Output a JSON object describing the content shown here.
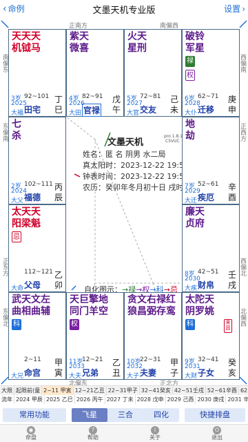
{
  "header": {
    "back_label": "命例",
    "title": "文墨天机专业版",
    "settings_label": "设置"
  },
  "directions": {
    "top_left": "正南方",
    "top_right": "南偏西",
    "left_upper": "南偏东",
    "right_upper": "西偏南",
    "left_mid": "东偏南",
    "right_mid": "正西方",
    "left_lower": "正东方",
    "right_lower": "西偏北",
    "left_bottom": "东偏北",
    "right_bottom": "北偏西",
    "bottom_left": "北偏东",
    "bottom_right": "正北方"
  },
  "palaces": [
    {
      "id": "si",
      "stars": "天天天\n机钺马",
      "color": "red",
      "age": "3岁",
      "range": "92~101",
      "year": "2025",
      "tag": "大福",
      "name": "田宅",
      "stem": "丁",
      "branch": "巳",
      "badges": []
    },
    {
      "id": "wu",
      "stars": "紫天\n微喜",
      "color": "purple",
      "age": "4岁",
      "range": "82~91",
      "year": "2026",
      "tag": "大田",
      "name": "官禄",
      "stem": "戊",
      "branch": "午",
      "badges": [],
      "boxed": true
    },
    {
      "id": "wei",
      "stars": "火天\n星刑",
      "color": "purple",
      "age": "5岁",
      "range": "72~81",
      "year": "2027",
      "tag": "大官",
      "name": "交友",
      "stem": "己",
      "branch": "未",
      "badges": []
    },
    {
      "id": "shen",
      "stars": "破铃\n军星",
      "color": "purple",
      "age": "6岁",
      "range": "62~71",
      "year": "2028",
      "tag": "大仆",
      "name": "迁移",
      "stem": "庚",
      "branch": "申",
      "badges": [
        "禄",
        "权"
      ]
    },
    {
      "id": "chen",
      "stars": "七\n杀",
      "color": "purple",
      "age": "2岁",
      "range": "102~111",
      "year": "2024",
      "tag": "大父",
      "name": "福德",
      "stem": "丙",
      "branch": "辰",
      "badges": []
    },
    {
      "id": "you",
      "stars": "地\n劫",
      "color": "purple",
      "age": "7岁",
      "range": "52~61",
      "year": "2029",
      "tag": "大迁",
      "name": "疾厄",
      "stem": "辛",
      "branch": "酉",
      "badges": []
    },
    {
      "id": "mao",
      "stars": "太天天\n阳梁魁",
      "color": "red",
      "age": "",
      "range": "112~121",
      "year": "",
      "tag": "大命",
      "name": "父母",
      "stem": "乙",
      "branch": "卯",
      "badges": [
        "忌"
      ]
    },
    {
      "id": "xu",
      "stars": "廉天\n贞府",
      "color": "purple",
      "age": "8岁",
      "range": "42~51",
      "year": "2030",
      "tag": "大疾",
      "name": "财帛",
      "stem": "壬",
      "branch": "戌",
      "badges": []
    },
    {
      "id": "yin",
      "stars": "武天文左\n曲相曲辅",
      "color": "purple",
      "age": "",
      "range": "2~11",
      "year": "",
      "tag": "大兄",
      "name": "命宫",
      "stem": "甲",
      "branch": "寅",
      "badges": [
        "科"
      ]
    },
    {
      "id": "chou",
      "stars": "天巨擎地\n同门羊空",
      "color": "purple",
      "age": "11岁",
      "range": "12~21",
      "year": "2033",
      "tag": "大夫",
      "name": "兄弟",
      "stem": "乙",
      "branch": "丑",
      "badges": [
        "权"
      ]
    },
    {
      "id": "zi",
      "stars": "贪文右禄红\n狼昌弼存鸾",
      "color": "purple",
      "age": "10岁",
      "range": "22~31",
      "year": "2032",
      "tag": "大子",
      "name": "夫妻",
      "stem": "甲",
      "branch": "子",
      "badges": []
    },
    {
      "id": "hai",
      "stars": "太陀天\n阴罗姚",
      "color": "purple",
      "age": "9岁",
      "range": "32~41",
      "year": "2031",
      "tag": "大财",
      "name": "子女",
      "stem": "癸",
      "branch": "亥",
      "badges": [
        "科",
        "来因"
      ]
    }
  ],
  "center": {
    "title": "文墨天机",
    "version": "pro 1.8.11",
    "code": "C5VUC",
    "name_line": "姓名：匿 名      阴男 水二局",
    "solar_line": "真太阳时：2023-12-22 19:51",
    "clock_line": "钟表时间：2023-12-22 19:50",
    "lunar_line": "农历：癸卯年冬月初十日 戌时",
    "legend_label": "自化图示：",
    "legend_lu": "→禄",
    "legend_quan": "→权",
    "legend_ke": "→科",
    "legend_ji": "→忌"
  },
  "daxian_row": [
    "大限",
    "起限前(童",
    "2~11 甲寅",
    "12~21乙丑",
    "22~31甲子",
    "32~41癸亥",
    "42~51壬戌",
    "52~61辛酉",
    "62~71庚申",
    "72~81己未"
  ],
  "liunian_row": [
    "流年",
    "2024 甲辰",
    "2025 乙巳",
    "2026 丙午",
    "2027 丁未",
    "2028 戊申",
    "2029 己酉",
    "2030 庚戌",
    "2031 辛亥",
    "2032 壬子"
  ],
  "modes": [
    "常用功能",
    "飞星",
    "三合",
    "四化",
    "快捷排盘"
  ],
  "active_mode": "飞星",
  "tabs": [
    "命盘",
    "帮助",
    "关于",
    "退出"
  ],
  "colors": {
    "red": "#d0002a",
    "purple": "#5c1a8a",
    "blue": "#1e3fa8",
    "green": "#2e7d32"
  }
}
